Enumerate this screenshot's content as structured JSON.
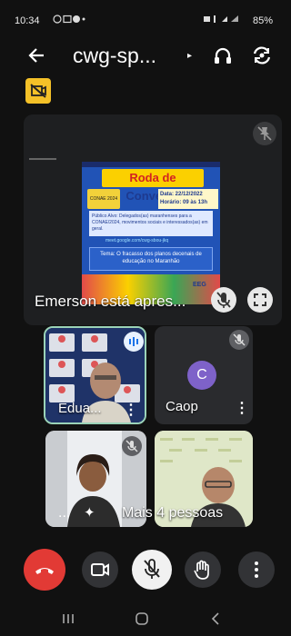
{
  "status_bar": {
    "time": "10:34",
    "battery": "85%"
  },
  "top_bar": {
    "meeting_title": "cwg-sp..."
  },
  "presentation": {
    "presenter_label": "Emerson está apres...",
    "slide": {
      "title_part1": "Roda de",
      "title_part2": "Conversa",
      "date": "Data: 22/12/2022",
      "time": "Horário: 09 às 13h",
      "logo_text": "CONAE 2024",
      "body": "Público Alvo: Delegados(as) maranhenses para a CONAE/2024, movimentos sociais e interessados(as) em geral.",
      "link": "meet.google.com/cwg-sbou-jkq",
      "theme": "Tema: O fracasso dos planos decenais de educação no Maranhão",
      "footer_label": "EEG"
    }
  },
  "participants": [
    {
      "name": "Edua...",
      "more": "⋮"
    },
    {
      "name": "Caop",
      "avatar_letter": "C",
      "more": "⋮"
    },
    {
      "name": "...",
      "more": ""
    },
    {
      "name": "",
      "more": ""
    }
  ],
  "more_people": "Mais 4 pessoas",
  "colors": {
    "end_call": "#e23a35",
    "badge_yellow": "#f4c128",
    "avatar_purple": "#7e62c9"
  }
}
